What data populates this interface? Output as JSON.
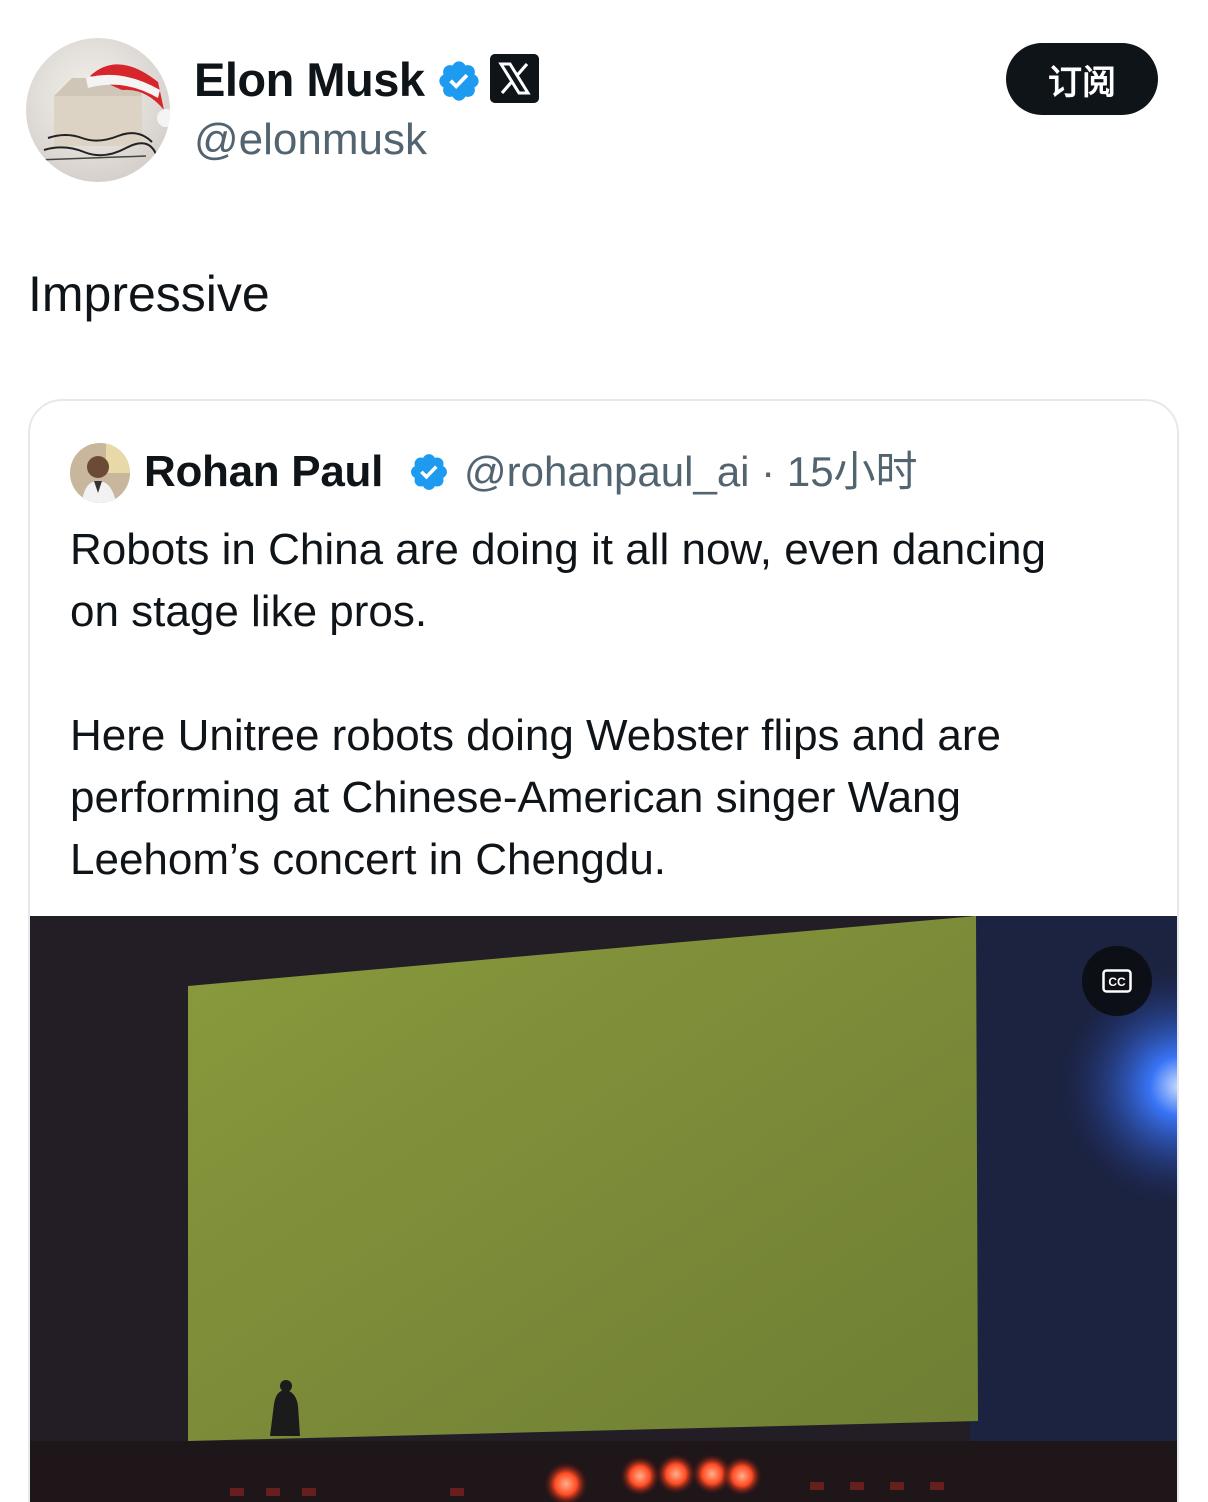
{
  "author": {
    "name": "Elon Musk",
    "handle": "@elonmusk",
    "verified_color": "#1d9bf0"
  },
  "subscribe_button": {
    "label": "订阅"
  },
  "tweet": {
    "text": "Impressive"
  },
  "quoted_tweet": {
    "author_name": "Rohan Paul",
    "meta": "@rohanpaul_ai · 15小时",
    "paragraphs": [
      "Robots in China are doing it all now, even dancing\non stage like pros.",
      "Here Unitree robots doing Webster flips and are\nperforming at Chinese-American singer Wang\nLeehom’s concert in Chengdu."
    ],
    "video": {
      "cc_icon": "closed-captions-icon",
      "screen_color": "#7c8b3c",
      "glow_color": "#2b6cff"
    }
  },
  "icons": {
    "verified": "verified-badge-icon",
    "x_logo": "x-logo-icon"
  }
}
